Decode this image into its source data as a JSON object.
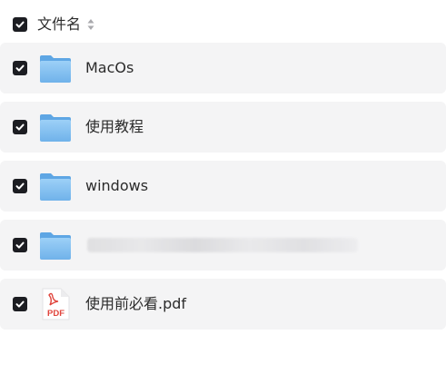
{
  "header": {
    "column_label": "文件名",
    "sort_icon": "sort-icon",
    "checked": true
  },
  "files": [
    {
      "name": "MacOs",
      "type": "folder",
      "icon": "folder-icon",
      "checked": true
    },
    {
      "name": "使用教程",
      "type": "folder",
      "icon": "folder-icon",
      "checked": true
    },
    {
      "name": "windows",
      "type": "folder",
      "icon": "folder-icon",
      "checked": true
    },
    {
      "name": "",
      "type": "folder",
      "icon": "folder-icon",
      "checked": true,
      "redacted": true
    },
    {
      "name": "使用前必看.pdf",
      "type": "pdf",
      "icon": "pdf-file-icon",
      "checked": true
    }
  ],
  "colors": {
    "checkbox": "#1c1d22",
    "row_background": "#f4f4f5",
    "folder": "#7ab8ec",
    "pdf_accent": "#e0443c"
  }
}
